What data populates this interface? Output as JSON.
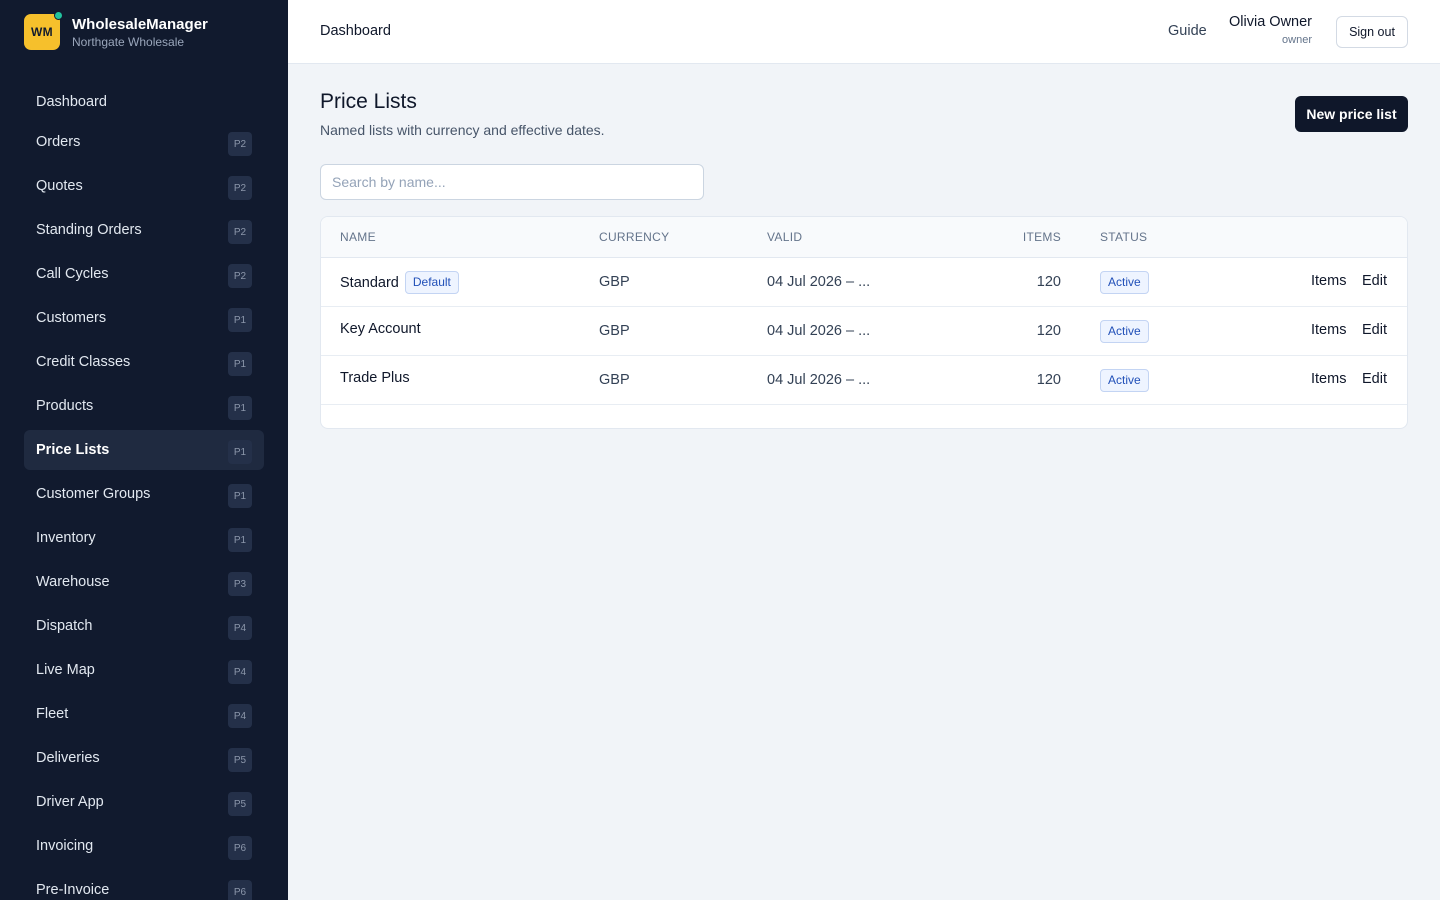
{
  "brand": {
    "logo": "WM",
    "name": "WholesaleManager",
    "org": "Northgate Wholesale"
  },
  "sidebar": {
    "items": [
      {
        "label": "Dashboard",
        "badge": ""
      },
      {
        "label": "Orders",
        "badge": "P2"
      },
      {
        "label": "Quotes",
        "badge": "P2"
      },
      {
        "label": "Standing Orders",
        "badge": "P2"
      },
      {
        "label": "Call Cycles",
        "badge": "P2"
      },
      {
        "label": "Customers",
        "badge": "P1"
      },
      {
        "label": "Credit Classes",
        "badge": "P1"
      },
      {
        "label": "Products",
        "badge": "P1"
      },
      {
        "label": "Price Lists",
        "badge": "P1",
        "active": true
      },
      {
        "label": "Customer Groups",
        "badge": "P1"
      },
      {
        "label": "Inventory",
        "badge": "P1"
      },
      {
        "label": "Warehouse",
        "badge": "P3"
      },
      {
        "label": "Dispatch",
        "badge": "P4"
      },
      {
        "label": "Live Map",
        "badge": "P4"
      },
      {
        "label": "Fleet",
        "badge": "P4"
      },
      {
        "label": "Deliveries",
        "badge": "P5"
      },
      {
        "label": "Driver App",
        "badge": "P5"
      },
      {
        "label": "Invoicing",
        "badge": "P6"
      },
      {
        "label": "Pre-Invoice",
        "badge": "P6"
      }
    ]
  },
  "header": {
    "breadcrumb": "Dashboard",
    "guide": "Guide",
    "user_name": "Olivia Owner",
    "user_role": "owner",
    "signout": "Sign out"
  },
  "page": {
    "title": "Price Lists",
    "subtitle": "Named lists with currency and effective dates.",
    "new_button": "New price list",
    "search_placeholder": "Search by name..."
  },
  "table": {
    "columns": {
      "name": "NAME",
      "currency": "CURRENCY",
      "valid": "VALID",
      "items": "ITEMS",
      "status": "STATUS"
    },
    "rows": [
      {
        "name": "Standard",
        "default_badge": "Default",
        "currency": "GBP",
        "valid": "04 Jul 2026 – ...",
        "items": "120",
        "status": "Active",
        "action_items": "Items",
        "action_edit": "Edit"
      },
      {
        "name": "Key Account",
        "currency": "GBP",
        "valid": "04 Jul 2026 – ...",
        "items": "120",
        "status": "Active",
        "action_items": "Items",
        "action_edit": "Edit"
      },
      {
        "name": "Trade Plus",
        "currency": "GBP",
        "valid": "04 Jul 2026 – ...",
        "items": "120",
        "status": "Active",
        "action_items": "Items",
        "action_edit": "Edit"
      }
    ]
  },
  "colors": {
    "sidebar_bg": "#111a2e",
    "logo": "#f6c02c",
    "status_dot": "#22c29e",
    "primary_button": "#0f172a",
    "chip_text": "#2150b8"
  }
}
